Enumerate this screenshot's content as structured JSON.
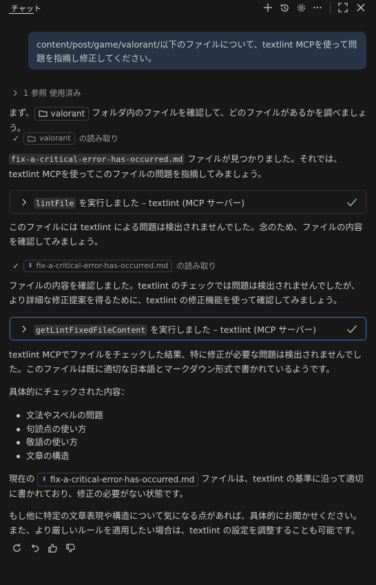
{
  "header": {
    "tab_label": "チャット",
    "icons": [
      "plus-icon",
      "history-icon",
      "gear-icon",
      "more-icon",
      "maximize-icon",
      "close-icon"
    ]
  },
  "user_message": {
    "text": "content/post/game/valorant/以下のファイルについて、textlint MCPを使って問題を指摘し修正してください。"
  },
  "reference": {
    "label": "1 参照 使用済み"
  },
  "p1": {
    "before": "まず、",
    "chip": "valorant",
    "after": " フォルダ内のファイルを確認して、どのファイルがあるかを調べましょう。"
  },
  "read1": {
    "chip": "valorant",
    "label": "の読み取り"
  },
  "p2": {
    "code": "fix-a-critical-error-has-occurred.md",
    "text": " ファイルが見つかりました。それでは、textlint MCPを使ってこのファイルの問題を指摘してみましょう。"
  },
  "tool1": {
    "code": "lintFile",
    "text": " を実行しました – textlint (MCP サーバー)"
  },
  "p3": {
    "text": "このファイルには textlint による問題は検出されませんでした。念のため、ファイルの内容を確認してみましょう。"
  },
  "read2": {
    "chip": "fix-a-critical-error-has-occurred.md",
    "label": "の読み取り"
  },
  "p4": {
    "text": "ファイルの内容を確認しました。textlint のチェックでは問題は検出されませんでしたが、より詳細な修正提案を得るために、textlint の修正機能を使って確認してみましょう。"
  },
  "tool2": {
    "code": "getLintFixedFileContent",
    "text": " を実行しました – textlint (MCP サーバー)"
  },
  "p5": {
    "text": "textlint MCPでファイルをチェックした結果、特に修正が必要な問題は検出されませんでした。このファイルは既に適切な日本語とマークダウン形式で書かれているようです。"
  },
  "p6": {
    "text": "具体的にチェックされた内容："
  },
  "bullets": [
    "文法やスペルの問題",
    "句読点の使い方",
    "敬語の使い方",
    "文章の構造"
  ],
  "p7": {
    "before": "現在の ",
    "chip": "fix-a-critical-error-has-occurred.md",
    "after": " ファイルは、textlint の基準に沿って適切に書かれており、修正の必要がない状態です。"
  },
  "p8": {
    "text": "もし他に特定の文章表現や構造について気になる点があれば、具体的にお聞かせください。また、より厳しいルールを適用したい場合は、textlint の設定を調整することも可能です。"
  },
  "actions": [
    "retry-icon",
    "undo-icon",
    "thumbs-up-icon",
    "thumbs-down-icon"
  ]
}
